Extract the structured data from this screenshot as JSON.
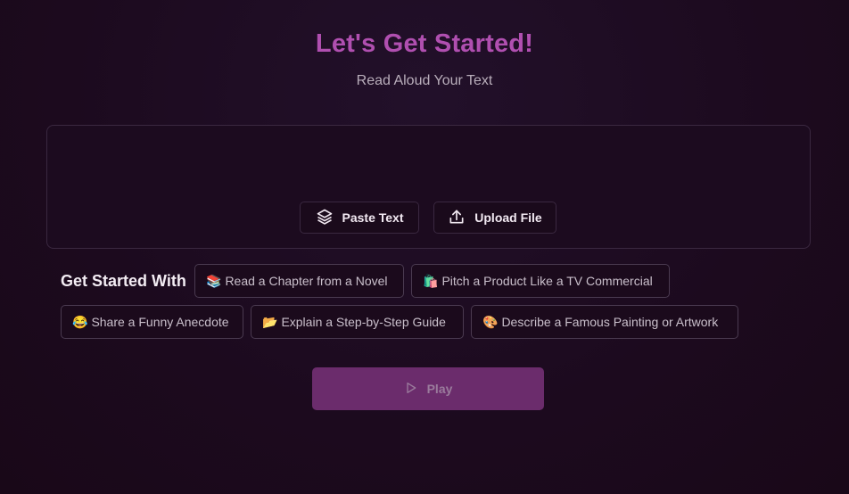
{
  "header": {
    "title": "Let's Get Started!",
    "subtitle": "Read Aloud Your Text"
  },
  "input_actions": {
    "paste_label": "Paste Text",
    "paste_icon": "layers-icon",
    "upload_label": "Upload File",
    "upload_icon": "upload-icon"
  },
  "suggestions": {
    "label": "Get Started With",
    "items": [
      {
        "emoji": "📚",
        "label": "Read a Chapter from a Novel"
      },
      {
        "emoji": "🛍️",
        "label": "Pitch a Product Like a TV Commercial"
      },
      {
        "emoji": "😂",
        "label": "Share a Funny Anecdote"
      },
      {
        "emoji": "📂",
        "label": "Explain a Step-by-Step Guide"
      },
      {
        "emoji": "🎨",
        "label": "Describe a Famous Painting or Artwork"
      }
    ]
  },
  "player": {
    "play_label": "Play",
    "play_icon": "play-icon"
  },
  "colors": {
    "background": "#1c0a1e",
    "title": "#b04fb0",
    "play_button": "#6b2c6c"
  }
}
